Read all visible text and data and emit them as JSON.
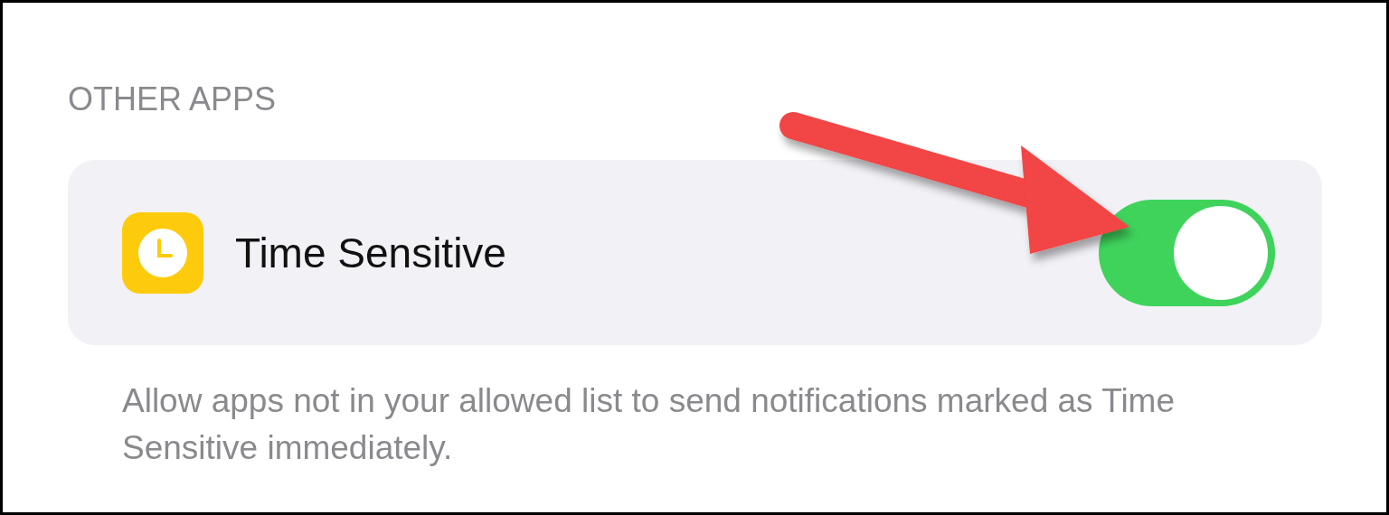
{
  "section_header": "OTHER APPS",
  "setting": {
    "label": "Time Sensitive",
    "on": true
  },
  "footer": "Allow apps not in your allowed list to send notifications marked as Time Sensitive immediately."
}
